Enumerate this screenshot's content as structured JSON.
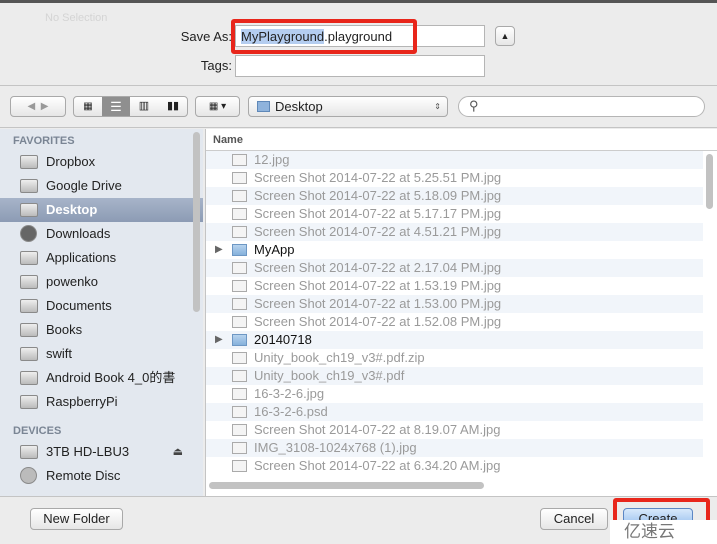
{
  "window": {
    "status": "No Selection"
  },
  "save_as": {
    "label": "Save As:",
    "value_selected": "MyPlayground",
    "value_ext": ".playground"
  },
  "tags": {
    "label": "Tags:",
    "value": ""
  },
  "toolbar": {
    "location": "Desktop",
    "search_placeholder": "",
    "views": [
      "icon-view",
      "list-view",
      "column-view",
      "coverflow-view"
    ],
    "active_view": "list-view"
  },
  "sidebar": {
    "favorites_header": "FAVORITES",
    "favorites": [
      {
        "label": "Dropbox",
        "icon": "folder-icon"
      },
      {
        "label": "Google Drive",
        "icon": "folder-icon"
      },
      {
        "label": "Desktop",
        "icon": "desktop-icon",
        "selected": true
      },
      {
        "label": "Downloads",
        "icon": "downloads-icon"
      },
      {
        "label": "Applications",
        "icon": "applications-icon"
      },
      {
        "label": "powenko",
        "icon": "folder-icon"
      },
      {
        "label": "Documents",
        "icon": "documents-icon"
      },
      {
        "label": "Books",
        "icon": "folder-icon"
      },
      {
        "label": "swift",
        "icon": "folder-icon"
      },
      {
        "label": "Android Book 4_0的書",
        "icon": "folder-icon"
      },
      {
        "label": "RaspberryPi",
        "icon": "folder-icon"
      }
    ],
    "devices_header": "DEVICES",
    "devices": [
      {
        "label": "3TB HD-LBU3",
        "icon": "drive-icon"
      },
      {
        "label": "Remote Disc",
        "icon": "disc-icon"
      }
    ]
  },
  "list": {
    "column_header": "Name",
    "rows": [
      {
        "name": "12.jpg"
      },
      {
        "name": "Screen Shot 2014-07-22 at 5.25.51 PM.jpg"
      },
      {
        "name": "Screen Shot 2014-07-22 at 5.18.09 PM.jpg"
      },
      {
        "name": "Screen Shot 2014-07-22 at 5.17.17 PM.jpg"
      },
      {
        "name": "Screen Shot 2014-07-22 at 4.51.21 PM.jpg"
      },
      {
        "name": "MyApp",
        "folder": true
      },
      {
        "name": "Screen Shot 2014-07-22 at 2.17.04 PM.jpg"
      },
      {
        "name": "Screen Shot 2014-07-22 at 1.53.19 PM.jpg"
      },
      {
        "name": "Screen Shot 2014-07-22 at 1.53.00 PM.jpg"
      },
      {
        "name": "Screen Shot 2014-07-22 at 1.52.08 PM.jpg"
      },
      {
        "name": "20140718",
        "folder": true
      },
      {
        "name": "Unity_book_ch19_v3#.pdf.zip"
      },
      {
        "name": "Unity_book_ch19_v3#.pdf"
      },
      {
        "name": "16-3-2-6.jpg"
      },
      {
        "name": "16-3-2-6.psd"
      },
      {
        "name": "Screen Shot 2014-07-22 at 8.19.07 AM.jpg"
      },
      {
        "name": "IMG_3108-1024x768 (1).jpg"
      },
      {
        "name": "Screen Shot 2014-07-22 at 6.34.20 AM.jpg"
      }
    ]
  },
  "footer": {
    "new_folder": "New Folder",
    "cancel": "Cancel",
    "create": "Create"
  },
  "watermark": "亿速云",
  "colors": {
    "highlight": "#e8261b",
    "selection": "#8c9bb4"
  }
}
